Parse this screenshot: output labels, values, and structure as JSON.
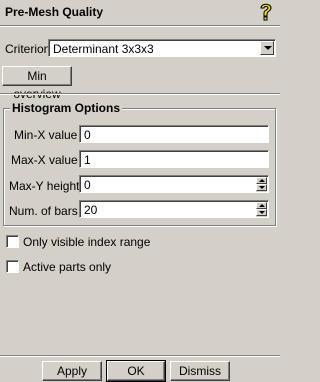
{
  "panel": {
    "title": "Pre-Mesh Quality",
    "help_icon": "help-question-icon"
  },
  "criterion": {
    "label": "Criterion",
    "selected": "Determinant 3x3x3"
  },
  "min_overview_button": "Min overview",
  "histogram": {
    "title": "Histogram Options",
    "min_x": {
      "label": "Min-X value",
      "value": "0"
    },
    "max_x": {
      "label": "Max-X value",
      "value": "1"
    },
    "max_y": {
      "label": "Max-Y height",
      "value": "0"
    },
    "num_bars": {
      "label": "Num. of bars",
      "value": "20"
    }
  },
  "options": {
    "only_visible": {
      "label": "Only visible index range",
      "checked": false
    },
    "active_parts": {
      "label": "Active parts only",
      "checked": false
    }
  },
  "footer": {
    "apply": "Apply",
    "ok": "OK",
    "dismiss": "Dismiss"
  }
}
